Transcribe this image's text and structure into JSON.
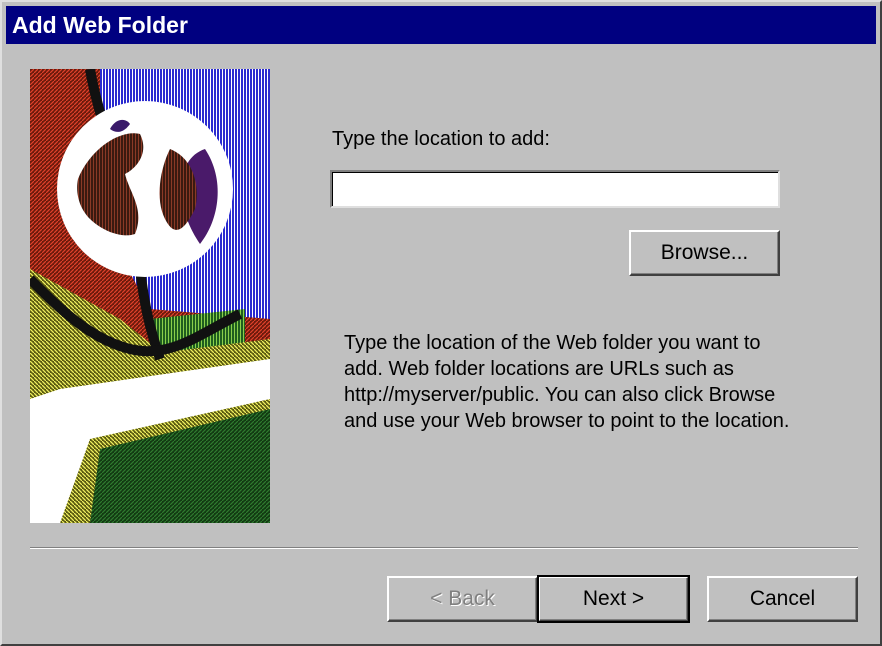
{
  "window": {
    "title": "Add Web Folder"
  },
  "form": {
    "location_label": "Type the location to add:",
    "location_value": "",
    "browse_label": "Browse...",
    "description_lines": [
      "Type the location of the Web folder you want to",
      "add.  Web folder locations are URLs such as",
      "http://myserver/public.  You can also click Browse",
      "and use your Web browser to point to the location."
    ]
  },
  "footer": {
    "back_label": "< Back",
    "next_label": "Next >",
    "cancel_label": "Cancel"
  },
  "illustration": {
    "name": "web-folder-globe-illustration"
  },
  "colors": {
    "titlebar": "#000080",
    "face": "#c0c0c0",
    "disabled_text": "#808080"
  }
}
